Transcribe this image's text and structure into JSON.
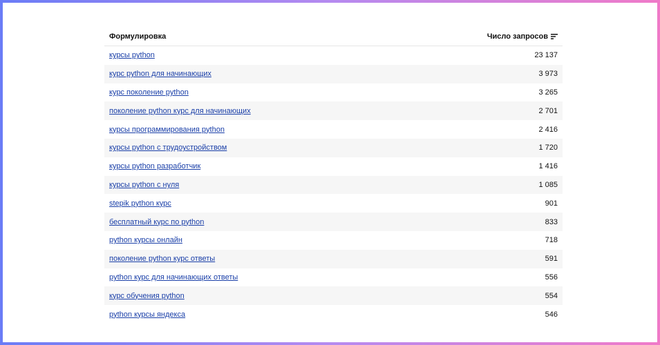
{
  "table": {
    "header": {
      "query_label": "Формулировка",
      "count_label": "Число запросов",
      "sort_icon": "sort-descending-icon"
    },
    "rows": [
      {
        "query": "курсы python",
        "count": "23 137"
      },
      {
        "query": "курс python для начинающих",
        "count": "3 973"
      },
      {
        "query": "курс поколение python",
        "count": "3 265"
      },
      {
        "query": "поколение python курс для начинающих",
        "count": "2 701"
      },
      {
        "query": "курсы программирования python",
        "count": "2 416"
      },
      {
        "query": "курсы python с трудоустройством",
        "count": "1 720"
      },
      {
        "query": "курсы python разработчик",
        "count": "1 416"
      },
      {
        "query": "курсы python с нуля",
        "count": "1 085"
      },
      {
        "query": "stepik python курс",
        "count": "901"
      },
      {
        "query": "бесплатный курс по python",
        "count": "833"
      },
      {
        "query": "python курсы онлайн",
        "count": "718"
      },
      {
        "query": "поколение python курс ответы",
        "count": "591"
      },
      {
        "query": "python курс для начинающих ответы",
        "count": "556"
      },
      {
        "query": "курс обучения python",
        "count": "554"
      },
      {
        "query": "python курсы яндекса",
        "count": "546"
      }
    ]
  },
  "colors": {
    "link": "#1a3fa8",
    "row_alt": "#f6f6f6",
    "frame_gradient_start": "#6a7cf6",
    "frame_gradient_end": "#f07ac8"
  }
}
